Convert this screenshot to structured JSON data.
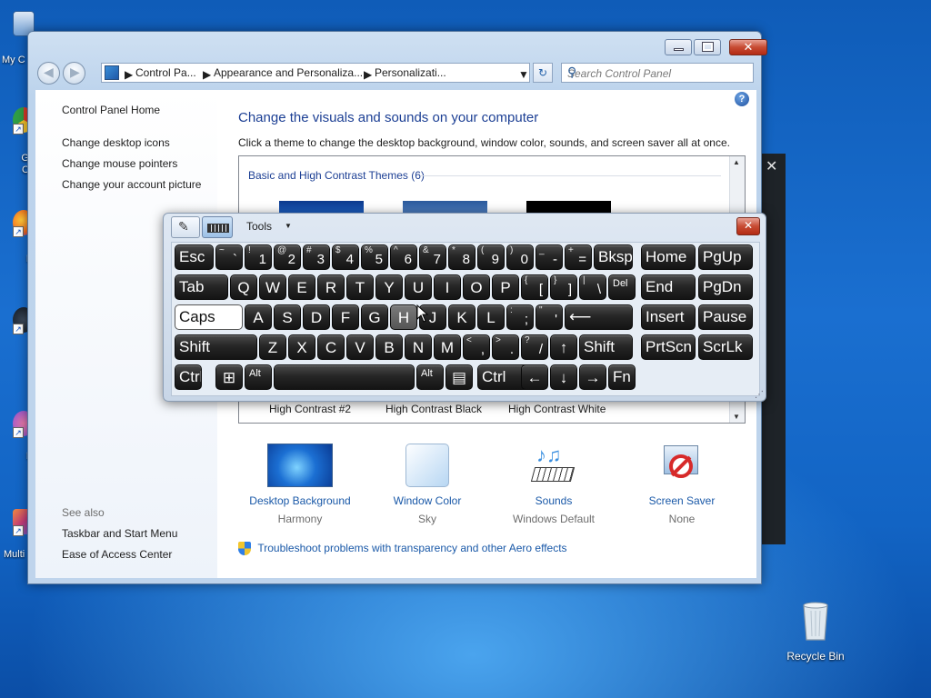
{
  "desktop": {
    "icons": [
      {
        "label": "My C"
      },
      {
        "label": "Go\nCh"
      },
      {
        "label": "Fi"
      },
      {
        "label": "S"
      },
      {
        "label": "M"
      },
      {
        "label": "Multi"
      }
    ],
    "recycle_bin": "Recycle Bin"
  },
  "window": {
    "breadcrumb": [
      "Control Pa...",
      "Appearance and Personaliza...",
      "Personalizati..."
    ],
    "search_placeholder": "Search Control Panel",
    "left_pane": {
      "home": "Control Panel Home",
      "links": [
        "Change desktop icons",
        "Change mouse pointers",
        "Change your account picture"
      ],
      "see_also_title": "See also",
      "see_also": [
        "Taskbar and Start Menu",
        "Ease of Access Center"
      ]
    },
    "main": {
      "title": "Change the visuals and sounds on your computer",
      "subtitle": "Click a theme to change the desktop background, window color, sounds, and screen saver all at once.",
      "group_label": "Basic and High Contrast Themes (6)",
      "theme_names": [
        "High Contrast #2",
        "High Contrast Black",
        "High Contrast White"
      ]
    },
    "bottom_items": [
      {
        "title": "Desktop Background",
        "sub": "Harmony"
      },
      {
        "title": "Window Color",
        "sub": "Sky"
      },
      {
        "title": "Sounds",
        "sub": "Windows Default"
      },
      {
        "title": "Screen Saver",
        "sub": "None"
      }
    ],
    "troubleshoot": "Troubleshoot problems with transparency and other Aero effects"
  },
  "osk": {
    "menu": "Tools",
    "rows": [
      [
        {
          "main": "Esc"
        },
        {
          "sup": "~",
          "base": "`"
        },
        {
          "sup": "!",
          "base": "1"
        },
        {
          "sup": "@",
          "base": "2"
        },
        {
          "sup": "#",
          "base": "3"
        },
        {
          "sup": "$",
          "base": "4"
        },
        {
          "sup": "%",
          "base": "5"
        },
        {
          "sup": "^",
          "base": "6"
        },
        {
          "sup": "&",
          "base": "7"
        },
        {
          "sup": "*",
          "base": "8"
        },
        {
          "sup": "(",
          "base": "9"
        },
        {
          "sup": ")",
          "base": "0"
        },
        {
          "sup": "_",
          "base": "-"
        },
        {
          "sup": "+",
          "base": "="
        },
        {
          "main": "Bksp"
        },
        {
          "main": "Home"
        },
        {
          "main": "PgUp"
        }
      ],
      [
        {
          "main": "Tab"
        },
        {
          "main": "Q"
        },
        {
          "main": "W"
        },
        {
          "main": "E"
        },
        {
          "main": "R"
        },
        {
          "main": "T"
        },
        {
          "main": "Y"
        },
        {
          "main": "U"
        },
        {
          "main": "I"
        },
        {
          "main": "O"
        },
        {
          "main": "P"
        },
        {
          "sup": "{",
          "base": "["
        },
        {
          "sup": "}",
          "base": "]"
        },
        {
          "sup": "|",
          "base": "\\"
        },
        {
          "main": "Del"
        },
        {
          "main": "End"
        },
        {
          "main": "PgDn"
        }
      ],
      [
        {
          "main": "Caps"
        },
        {
          "main": "A"
        },
        {
          "main": "S"
        },
        {
          "main": "D"
        },
        {
          "main": "F"
        },
        {
          "main": "G"
        },
        {
          "main": "H"
        },
        {
          "main": "J"
        },
        {
          "main": "K"
        },
        {
          "main": "L"
        },
        {
          "sup": ":",
          "base": ";"
        },
        {
          "sup": "\"",
          "base": "'"
        },
        {
          "main": "⟵"
        },
        {
          "main": "Insert"
        },
        {
          "main": "Pause"
        }
      ],
      [
        {
          "main": "Shift"
        },
        {
          "main": "Z"
        },
        {
          "main": "X"
        },
        {
          "main": "C"
        },
        {
          "main": "V"
        },
        {
          "main": "B"
        },
        {
          "main": "N"
        },
        {
          "main": "M"
        },
        {
          "sup": "<",
          "base": ","
        },
        {
          "sup": ">",
          "base": "."
        },
        {
          "sup": "?",
          "base": "/"
        },
        {
          "main": "↑"
        },
        {
          "main": "Shift"
        },
        {
          "main": "PrtScn"
        },
        {
          "main": "ScrLk"
        }
      ],
      [
        {
          "main": "Ctrl"
        },
        {
          "main": "⊞"
        },
        {
          "main": "Alt"
        },
        {
          "main": ""
        },
        {
          "main": "Alt"
        },
        {
          "main": "▤"
        },
        {
          "main": "Ctrl"
        },
        {
          "main": "←"
        },
        {
          "main": "↓"
        },
        {
          "main": "→"
        },
        {
          "main": "Fn"
        }
      ]
    ]
  },
  "colors": {
    "link_blue": "#1a59a8",
    "title_blue": "#1c3f94",
    "desktop_blue": "#1668c8",
    "key_black": "#1c1c1c"
  }
}
